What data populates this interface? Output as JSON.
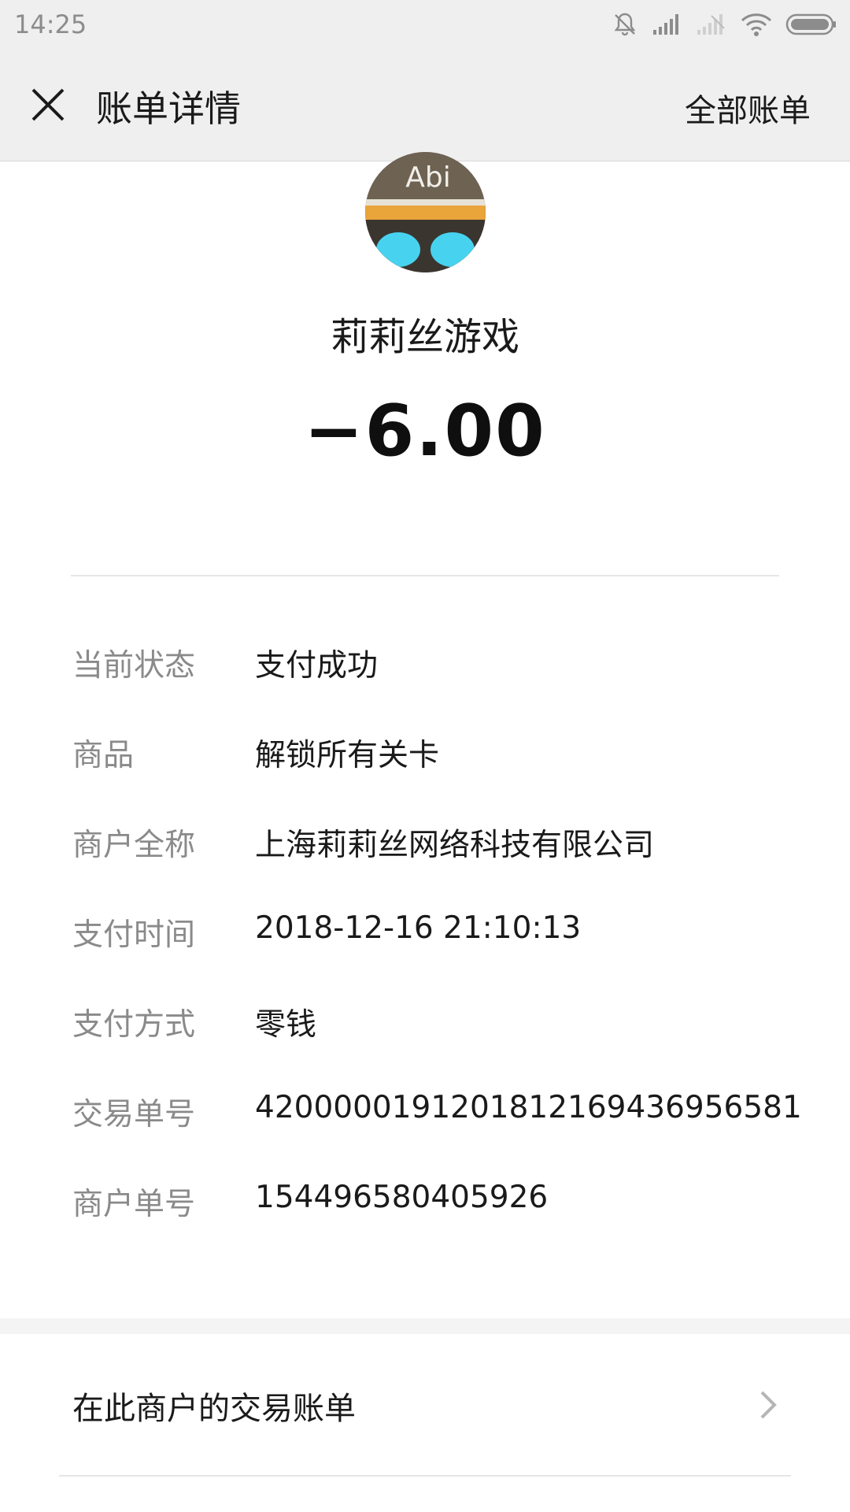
{
  "status_bar": {
    "time": "14:25",
    "icons": [
      "bell-muted-icon",
      "signal-icon",
      "signal-weak-icon",
      "wifi-icon",
      "battery-icon"
    ]
  },
  "nav": {
    "title": "账单详情",
    "right_action": "全部账单",
    "close_icon": "close-icon"
  },
  "merchant": {
    "avatar_text": "Abi",
    "name": "莉莉丝游戏"
  },
  "amount": "−6.00",
  "details": [
    {
      "label": "当前状态",
      "value": "支付成功"
    },
    {
      "label": "商品",
      "value": "解锁所有关卡"
    },
    {
      "label": "商户全称",
      "value": "上海莉莉丝网络科技有限公司"
    },
    {
      "label": "支付时间",
      "value": "2018-12-16 21:10:13"
    },
    {
      "label": "支付方式",
      "value": "零钱"
    },
    {
      "label": "交易单号",
      "value": "4200000191201812169436956581"
    },
    {
      "label": "商户单号",
      "value": "154496580405926"
    }
  ],
  "trade_bills": {
    "label": "在此商户的交易账单",
    "icon": "chevron-right-icon"
  },
  "colors": {
    "header_bg": "#efefef",
    "label_gray": "#8a8a8a",
    "text_dark": "#1a1a1a"
  }
}
